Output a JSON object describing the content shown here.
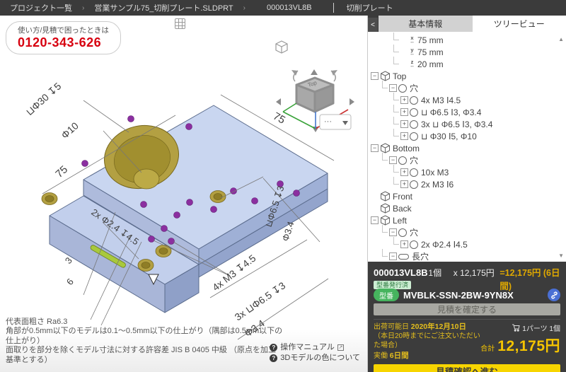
{
  "topbar": {
    "breadcrumb": [
      "プロジェクト一覧",
      "営業サンプル75_切削プレート.SLDPRT"
    ],
    "doc_tabs": [
      "000013VL8B",
      "切削プレート"
    ]
  },
  "phone": {
    "label": "使い方/見積で困ったときは",
    "number": "0120-343-626"
  },
  "viewer": {
    "more_button": "···",
    "annotations": {
      "cb30": "⊔Φ30 ↧5",
      "d10": "Φ10",
      "dim_left": "75",
      "dim_top": "75",
      "slot_holes": "2x Φ2.4 ↧4.5",
      "m3_holes": "4x M3 ↧4.5",
      "cb65": "⊔Φ6.5 ↧3",
      "d34a": "Φ3.4",
      "cb65x3": "3x ⊔Φ6.5 ↧3",
      "d34b": "Φ3.4",
      "edge3": "3",
      "edge6": "6",
      "navcube_top": "Top"
    }
  },
  "notes": {
    "lines": [
      "代表面粗さ Ra6.3",
      "角部が0.5mm以下のモデルは0.1～0.5mm以下の仕上がり（隅部は0.5mm以下の仕上がり）",
      "面取りを部分を除くモデル寸法に対する許容差 JIS B 0405 中級 （原点を加工基準とする）"
    ],
    "links": [
      "操作マニュアル",
      "3Dモデルの色について"
    ]
  },
  "panel": {
    "collapse": "<",
    "tabs": [
      {
        "label": "基本情報",
        "active": false
      },
      {
        "label": "ツリービュー",
        "active": true
      }
    ]
  },
  "tree": {
    "items": [
      {
        "ind": 2,
        "exp": null,
        "icon": "dim",
        "axis": "x",
        "label": "75 mm"
      },
      {
        "ind": 2,
        "exp": null,
        "icon": "dim",
        "axis": "y",
        "label": "75 mm"
      },
      {
        "ind": 2,
        "exp": null,
        "icon": "dim",
        "axis": "z",
        "label": "20 mm"
      },
      {
        "ind": 0,
        "exp": "-",
        "icon": "cube",
        "label": "Top"
      },
      {
        "ind": 1,
        "exp": "-",
        "icon": "circle",
        "label": "穴"
      },
      {
        "ind": 2,
        "exp": "+",
        "icon": "circle",
        "label": "4x M3 Ⅰ4.5"
      },
      {
        "ind": 2,
        "exp": "+",
        "icon": "circle",
        "label": "⊔ Φ6.5 Ⅰ3, Φ3.4"
      },
      {
        "ind": 2,
        "exp": "+",
        "icon": "circle",
        "label": "3x ⊔ Φ6.5 Ⅰ3, Φ3.4"
      },
      {
        "ind": 2,
        "exp": "+",
        "icon": "circle",
        "label": "⊔ Φ30 Ⅰ5, Φ10"
      },
      {
        "ind": 0,
        "exp": "-",
        "icon": "cube",
        "label": "Bottom"
      },
      {
        "ind": 1,
        "exp": "-",
        "icon": "circle",
        "label": "穴"
      },
      {
        "ind": 2,
        "exp": "+",
        "icon": "circle",
        "label": "10x M3"
      },
      {
        "ind": 2,
        "exp": "+",
        "icon": "circle",
        "label": "2x M3 Ⅰ6"
      },
      {
        "ind": 0,
        "exp": null,
        "icon": "cube",
        "label": "Front"
      },
      {
        "ind": 0,
        "exp": null,
        "icon": "cube",
        "label": "Back"
      },
      {
        "ind": 0,
        "exp": "-",
        "icon": "cube",
        "label": "Left"
      },
      {
        "ind": 1,
        "exp": "-",
        "icon": "circle",
        "label": "穴"
      },
      {
        "ind": 2,
        "exp": "+",
        "icon": "circle",
        "label": "2x Φ2.4 Ⅰ4.5"
      },
      {
        "ind": 1,
        "exp": "-",
        "icon": "slot",
        "label": "長穴"
      }
    ]
  },
  "order": {
    "part_id": "000013VL8B",
    "qty": "1個",
    "unit_price": "x 12,175円",
    "line_total": "=12,175円 (6日間)",
    "issued_badge": "型番発行済",
    "model_label": "型番",
    "model_number": "MVBLK-SSN-2BW-9YN8X",
    "confirm_button": "見積を確定する",
    "ship_title": "出荷可能日",
    "ship_date": "2020年12月10日",
    "ship_note": "（本日20時までにご注文いただいた場合）",
    "lead_label": "実働",
    "lead_value": "6日間",
    "cart_label": "1パーツ 1個",
    "total_label": "合計",
    "total_value": "12,175円",
    "proceed_button": "見積確認へ進む"
  }
}
